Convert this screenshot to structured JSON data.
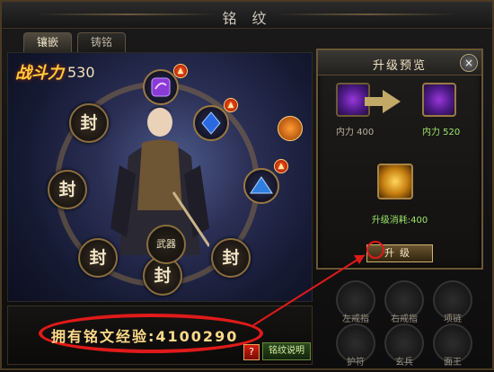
{
  "window": {
    "title": "铭 纹"
  },
  "tabs": [
    {
      "label": "镶嵌"
    },
    {
      "label": "铸铭"
    }
  ],
  "power": {
    "label": "战斗力",
    "value": "530"
  },
  "slots": [
    {
      "type": "seal",
      "label": "封"
    },
    {
      "type": "seal",
      "label": "封"
    },
    {
      "type": "seal",
      "label": "封"
    },
    {
      "type": "seal",
      "label": "封"
    },
    {
      "type": "seal",
      "label": "封"
    }
  ],
  "center_label": "武器",
  "experience": {
    "text": "拥有铭文经验:4100290"
  },
  "help": {
    "mark": "?"
  },
  "rules_button": {
    "label": "铭纹说明"
  },
  "preview": {
    "title": "升级预览",
    "close": "×",
    "before": {
      "stat": "内力 400"
    },
    "after": {
      "stat": "内力 520"
    },
    "cost": "升级消耗:400",
    "upgrade_label": "升级"
  },
  "equipment": [
    {
      "label": "左戒指"
    },
    {
      "label": "右戒指"
    },
    {
      "label": "项链"
    },
    {
      "label": "护符"
    },
    {
      "label": "玄兵"
    },
    {
      "label": "面王"
    }
  ],
  "colors": {
    "accent_gold": "#ffd98a",
    "highlight_red": "#e01a1a",
    "positive_green": "#9de86a"
  }
}
